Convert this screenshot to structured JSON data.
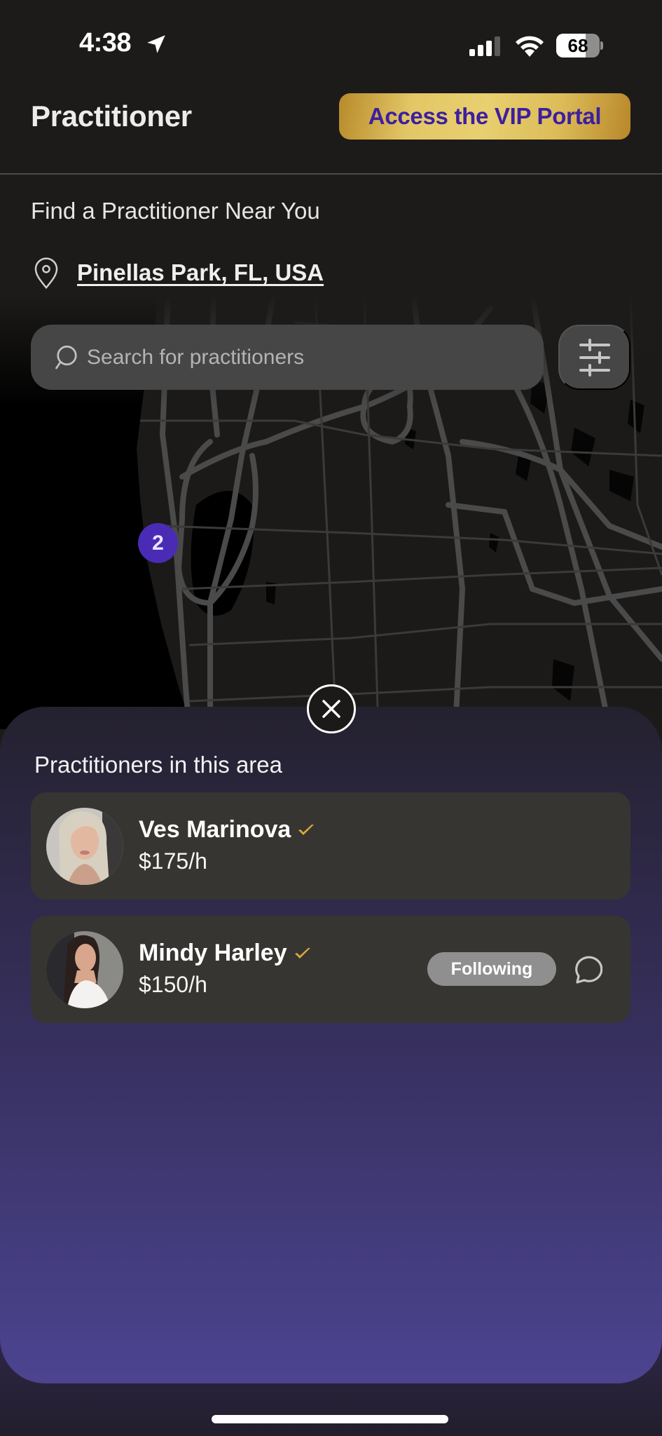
{
  "status_bar": {
    "time": "4:38",
    "battery_percent": 68,
    "battery_label": "68"
  },
  "header": {
    "title": "Practitioner",
    "vip_button_label": "Access the  VIP Portal"
  },
  "find": {
    "title": "Find a Practitioner Near You",
    "location": "Pinellas Park, FL, USA"
  },
  "search": {
    "placeholder": "Search for practitioners",
    "value": ""
  },
  "map": {
    "cluster_count": "2"
  },
  "sheet": {
    "title": "Practitioners in this area",
    "practitioners": [
      {
        "name": "Ves Marinova",
        "verified": true,
        "price": "$175/h",
        "following_label": null
      },
      {
        "name": "Mindy Harley",
        "verified": true,
        "price": "$150/h",
        "following_label": "Following"
      }
    ]
  },
  "colors": {
    "accent_purple": "#4a2bb5",
    "vip_text": "#3d1fa0",
    "gold": "#e3c766",
    "verified_gold": "#d9a93a"
  }
}
